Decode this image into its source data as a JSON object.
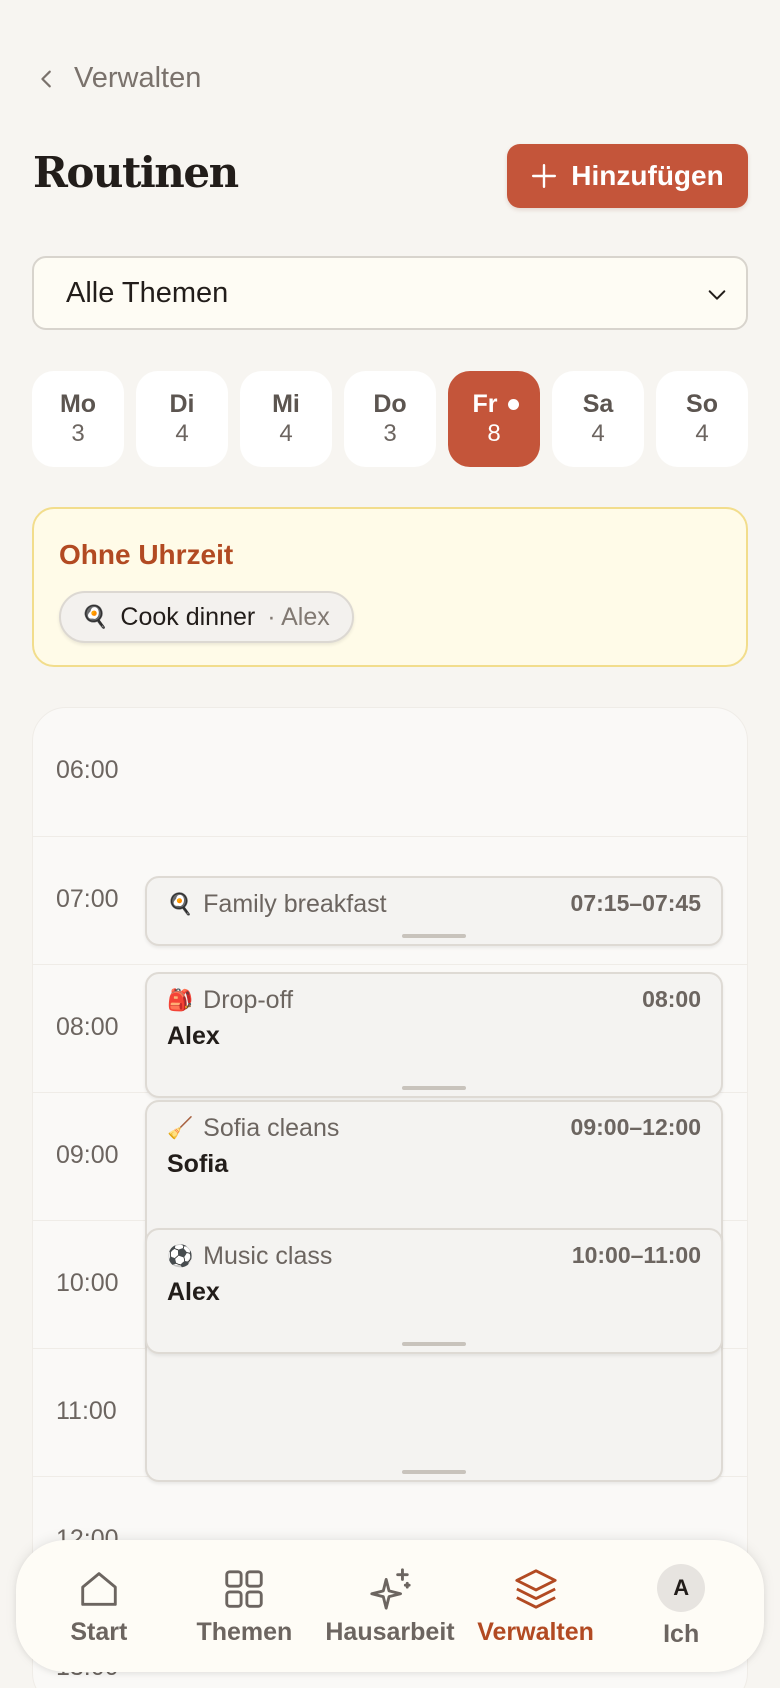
{
  "back": {
    "label": "Verwalten"
  },
  "header": {
    "title": "Routinen",
    "add_label": "Hinzufügen"
  },
  "filter": {
    "selected": "Alle Themen"
  },
  "days": [
    {
      "name": "Mo",
      "count": "3",
      "active": false
    },
    {
      "name": "Di",
      "count": "4",
      "active": false
    },
    {
      "name": "Mi",
      "count": "4",
      "active": false
    },
    {
      "name": "Do",
      "count": "3",
      "active": false
    },
    {
      "name": "Fr",
      "count": "8",
      "active": true
    },
    {
      "name": "Sa",
      "count": "4",
      "active": false
    },
    {
      "name": "So",
      "count": "4",
      "active": false
    }
  ],
  "untimed": {
    "heading": "Ohne Uhrzeit",
    "items": [
      {
        "emoji": "🍳",
        "title": "Cook dinner",
        "person": "· Alex"
      }
    ]
  },
  "hours": [
    "06:00",
    "07:00",
    "08:00",
    "09:00",
    "10:00",
    "11:00",
    "12:00",
    "13:00"
  ],
  "events": [
    {
      "emoji": "🍳",
      "title": "Family breakfast",
      "time": "07:15–07:45",
      "person": ""
    },
    {
      "emoji": "🎒",
      "title": "Drop-off",
      "time": "08:00",
      "person": "Alex"
    },
    {
      "emoji": "🧹",
      "title": "Sofia cleans",
      "time": "09:00–12:00",
      "person": "Sofia"
    },
    {
      "emoji": "⚽",
      "title": "Music class",
      "time": "10:00–11:00",
      "person": "Alex"
    }
  ],
  "nav": {
    "items": [
      {
        "label": "Start",
        "icon": "home-icon"
      },
      {
        "label": "Themen",
        "icon": "grid-icon"
      },
      {
        "label": "Hausarbeit",
        "icon": "sparkle-icon"
      },
      {
        "label": "Verwalten",
        "icon": "layers-icon"
      },
      {
        "label": "Ich",
        "icon": "avatar",
        "initial": "A"
      }
    ],
    "active": "Verwalten"
  },
  "colors": {
    "accent": "#c4553a",
    "accent_text": "#b24a22",
    "untimed_bg": "#fffbe8",
    "untimed_border": "#f2dd8c"
  }
}
